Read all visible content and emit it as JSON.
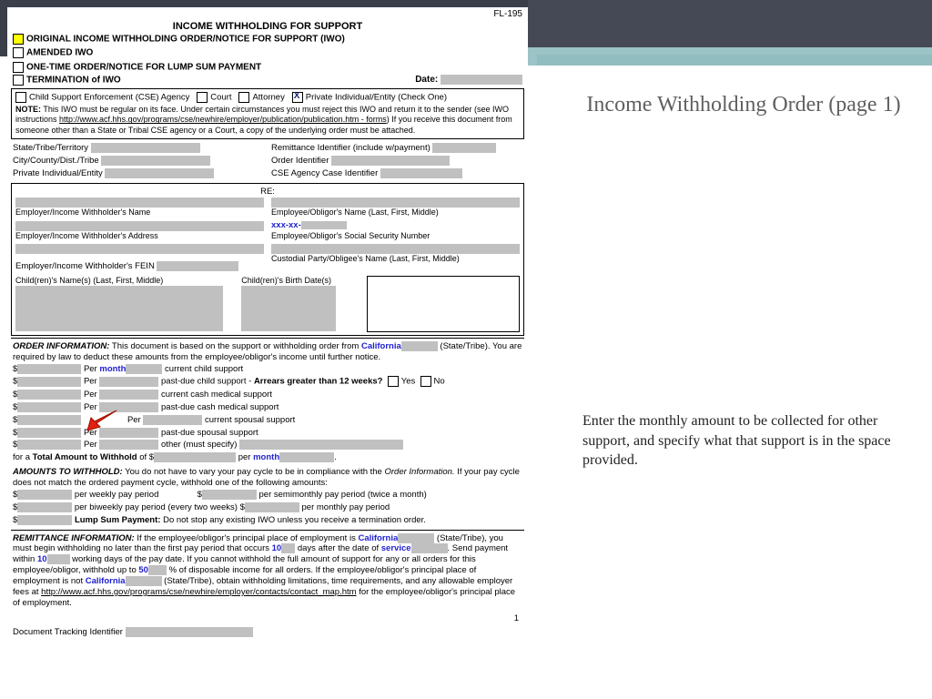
{
  "header": {
    "form_number": "FL-195",
    "title": "INCOME WITHHOLDING FOR SUPPORT"
  },
  "options": {
    "original": "ORIGINAL INCOME WITHHOLDING ORDER/NOTICE FOR SUPPORT (IWO)",
    "amended": "AMENDED IWO",
    "onetime": "ONE-TIME ORDER/NOTICE FOR LUMP SUM PAYMENT",
    "termination": "TERMINATION of IWO",
    "date_label": "Date:"
  },
  "checkone": {
    "cse": "Child Support Enforcement (CSE) Agency",
    "court": "Court",
    "attorney": "Attorney",
    "private": "Private Individual/Entity",
    "suffix": "  (Check One)"
  },
  "note": {
    "label": "NOTE:",
    "text1": " This IWO must be regular on its face. Under certain circumstances you must reject this IWO and return it to the sender (see IWO instructions ",
    "link1": "http://www.acf.hhs.gov/programs/cse/newhire/employer/publication/publication.htm - forms",
    "text2": ") If you receive this document from someone other than a State or Tribal CSE agency or a Court, a copy of the underlying order must be attached."
  },
  "ids": {
    "state": "State/Tribe/Territory",
    "city": "City/County/Dist./Tribe",
    "priv": "Private Individual/Entity",
    "remit": "Remittance Identifier (include w/payment)",
    "order": "Order Identifier",
    "cse": "CSE Agency Case Identifier"
  },
  "party": {
    "re": "RE:",
    "emp_name": "Employer/Income Withholder's Name",
    "emp_addr": "Employer/Income Withholder's Address",
    "emp_fein": "Employer/Income Withholder's FEIN",
    "obligor": "Employee/Obligor's Name (Last, First, Middle)",
    "ssn_prefix": "xxx-xx-",
    "ssn": "Employee/Obligor's Social Security Number",
    "obligee": "Custodial Party/Obligee's Name (Last, First, Middle)",
    "children": "Child(ren)'s Name(s) (Last, First, Middle)",
    "dob": "Child(ren)'s Birth Date(s)"
  },
  "order": {
    "heading": "ORDER INFORMATION:",
    "intro1": " This document is based on the support or withholding order from ",
    "state": "California",
    "intro2": " (State/Tribe). You are required by law to deduct these amounts from the employee/obligor's income until further notice.",
    "per": "Per",
    "month": "month",
    "items": [
      "current child support",
      "past-due child support - ",
      "current cash medical support",
      "past-due cash medical support",
      "current spousal support",
      "past-due spousal support",
      "other (must specify)"
    ],
    "arrears_label": "Arrears greater than 12 weeks?",
    "yes": "Yes",
    "no": "No",
    "total1": "for a ",
    "total2": "Total Amount to Withhold",
    "total3": " of $",
    "per2": " per "
  },
  "amounts": {
    "heading": "AMOUNTS TO WITHHOLD:",
    "intro": " You do not have to vary your pay cycle to be in compliance with the ",
    "italic": "Order Information.",
    "intro2": "  If your pay cycle does not match the ordered payment cycle, withhold one of the following amounts:",
    "weekly": " per weekly pay period",
    "semimonthly": " per semimonthly pay period (twice a month)",
    "biweekly": " per biweekly pay period (every two weeks) $",
    "monthly": " per monthly pay period",
    "lump1": "Lump Sum Payment:",
    "lump2": " Do not stop any existing IWO unless you receive a termination order."
  },
  "remit": {
    "heading": "REMITTANCE INFORMATION:",
    "t1": " If the employee/obligor's principal place of employment is ",
    "state": "California",
    "t2": " (State/Tribe), you must begin withholding no later than the first pay period that occurs ",
    "v1": "10",
    "t3": " days after the date of ",
    "service": "service",
    "t4": ". Send payment within ",
    "v2": "10",
    "t5": " working days of the pay date. If you cannot withhold the full amount of support for any or all orders for this employee/obligor, withhold up to ",
    "v3": "50",
    "t6": " % of disposable income for all orders. If the employee/obligor's principal place of employment is not ",
    "state2": "California",
    "t7": " (State/Tribe), obtain withholding limitations, time requirements, and any allowable employer fees at ",
    "link": "http://www.acf.hhs.gov/programs/cse/newhire/employer/contacts/contact_map.htm",
    "t8": " for the employee/obligor's principal place of employment."
  },
  "footer": {
    "pagenum": "1",
    "track": "Document Tracking Identifier"
  },
  "slide": {
    "title": "Income Withholding Order (page 1)",
    "body": "Enter the monthly amount to be collected for other support, and specify what that support is in the space provided."
  }
}
